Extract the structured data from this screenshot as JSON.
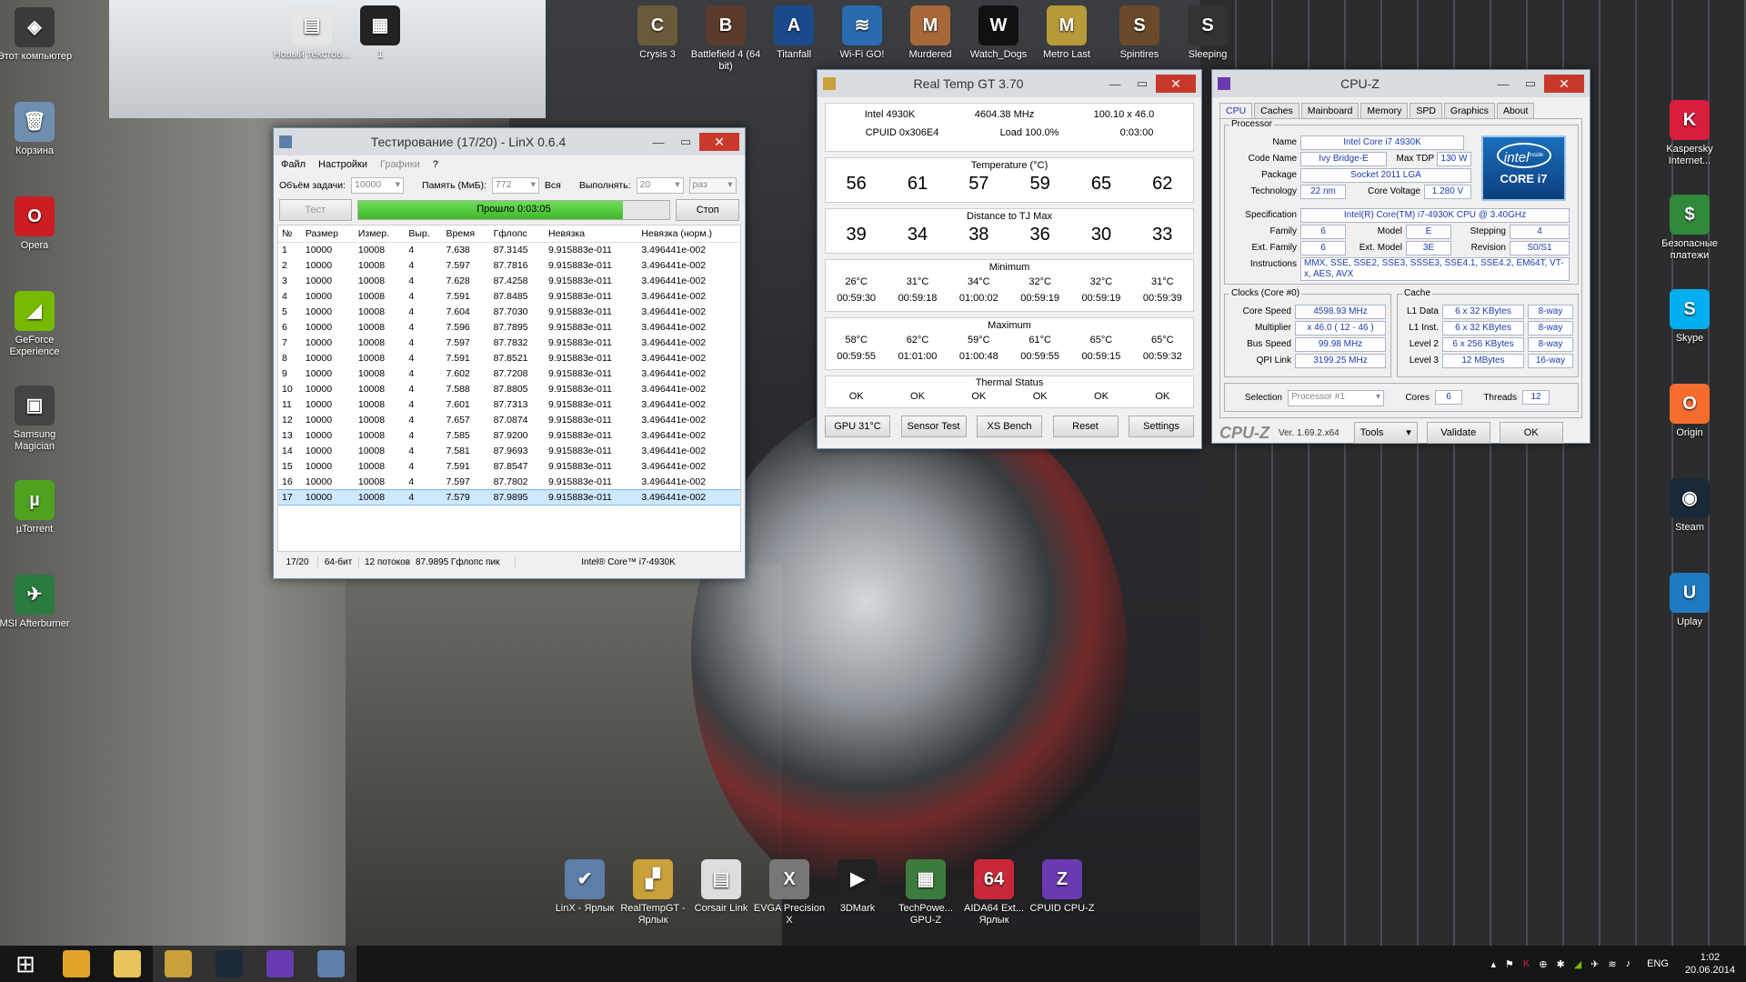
{
  "desktop_icons_left": [
    {
      "label": "Этот компьютер",
      "name": "this-pc-icon",
      "color": "#3a3a3a",
      "glyph": "◈"
    },
    {
      "label": "Корзина",
      "name": "recycle-bin-icon",
      "color": "#6f8fb0",
      "glyph": "🗑"
    },
    {
      "label": "Opera",
      "name": "opera-icon",
      "color": "#cc1d22",
      "glyph": "O"
    },
    {
      "label": "GeForce Experience",
      "name": "geforce-icon",
      "color": "#76b900",
      "glyph": "◢"
    },
    {
      "label": "Samsung Magician",
      "name": "samsung-magician-icon",
      "color": "#444",
      "glyph": "▣"
    },
    {
      "label": "µTorrent",
      "name": "utorrent-icon",
      "color": "#4ea21e",
      "glyph": "µ"
    },
    {
      "label": "MSI Afterburner",
      "name": "afterburner-icon",
      "color": "#2b7a3f",
      "glyph": "✈"
    }
  ],
  "desktop_icons_top": [
    {
      "label": "Новый текстов...",
      "name": "new-text-icon",
      "color": "#e6e6e6",
      "glyph": "▤"
    },
    {
      "label": "1",
      "name": "image-icon",
      "color": "#222",
      "glyph": "▦"
    },
    {
      "label": "Crysis 3",
      "name": "crysis-icon",
      "color": "#6b5a3a",
      "glyph": "C"
    },
    {
      "label": "Battlefield 4 (64 bit)",
      "name": "battlefield-icon",
      "color": "#5a3a2a",
      "glyph": "B"
    },
    {
      "label": "Titanfall",
      "name": "titanfall-icon",
      "color": "#1b4a8c",
      "glyph": "A"
    },
    {
      "label": "Wi-Fi GO!",
      "name": "wifi-go-icon",
      "color": "#2a6bb0",
      "glyph": "≋"
    },
    {
      "label": "Murdered",
      "name": "murdered-icon",
      "color": "#a8683a",
      "glyph": "M"
    },
    {
      "label": "Watch_Dogs",
      "name": "watchdogs-icon",
      "color": "#111",
      "glyph": "W"
    },
    {
      "label": "Metro Last",
      "name": "metro-icon",
      "color": "#b89a3a",
      "glyph": "M"
    },
    {
      "label": "Spintires",
      "name": "spintires-icon",
      "color": "#6a4a2a",
      "glyph": "S"
    },
    {
      "label": "Sleeping",
      "name": "sleeping-dogs-icon",
      "color": "#333",
      "glyph": "S"
    }
  ],
  "desktop_icons_right": [
    {
      "label": "Kaspersky Internet...",
      "name": "kaspersky-icon",
      "color": "#d81e3c",
      "glyph": "K"
    },
    {
      "label": "Безопасные платежи",
      "name": "safe-money-icon",
      "color": "#2f8a3a",
      "glyph": "$"
    },
    {
      "label": "Skype",
      "name": "skype-icon",
      "color": "#00aff0",
      "glyph": "S"
    },
    {
      "label": "Origin",
      "name": "origin-icon",
      "color": "#f56c2d",
      "glyph": "O"
    },
    {
      "label": "Steam",
      "name": "steam-icon",
      "color": "#1b2838",
      "glyph": "◉"
    },
    {
      "label": "Uplay",
      "name": "uplay-icon",
      "color": "#1f7bc1",
      "glyph": "U"
    }
  ],
  "desktop_icons_bottom": [
    {
      "label": "LinX - Ярлык",
      "name": "linx-shortcut-icon",
      "color": "#5c7ea8",
      "glyph": "✔"
    },
    {
      "label": "RealTempGT - Ярлык",
      "name": "realtemp-shortcut-icon",
      "color": "#c9a03a",
      "glyph": "▞"
    },
    {
      "label": "Corsair Link",
      "name": "corsair-icon",
      "color": "#ddd",
      "glyph": "▤"
    },
    {
      "label": "EVGA Precision X",
      "name": "evga-icon",
      "color": "#777",
      "glyph": "X"
    },
    {
      "label": "3DMark",
      "name": "3dmark-icon",
      "color": "#222",
      "glyph": "▶"
    },
    {
      "label": "TechPowe... GPU-Z",
      "name": "gpuz-icon",
      "color": "#3d7a3d",
      "glyph": "▦"
    },
    {
      "label": "AIDA64 Ext... Ярлык",
      "name": "aida64-icon",
      "color": "#c8283a",
      "glyph": "64"
    },
    {
      "label": "CPUID CPU-Z",
      "name": "cpuz-icon",
      "color": "#6a3ab0",
      "glyph": "Z"
    }
  ],
  "linx": {
    "title": "Тестирование (17/20) - LinX 0.6.4",
    "menu": [
      "Файл",
      "Настройки",
      "Графики",
      "?"
    ],
    "size_label": "Объём задачи:",
    "size_value": "10000",
    "mem_label": "Память (МиБ):",
    "mem_value": "772",
    "all_label": "Вся",
    "runs_label": "Выполнять:",
    "runs_value": "20",
    "runs_unit": "раз",
    "test_button": "Тест",
    "progress_text": "Прошло 0:03:05",
    "progress": 0.85,
    "stop_button": "Стоп",
    "columns": [
      "№",
      "Размер",
      "Измер.",
      "Выр.",
      "Время",
      "Гфлопс",
      "Невязка",
      "Невязка (норм.)"
    ],
    "rows": [
      [
        "1",
        "10000",
        "10008",
        "4",
        "7.638",
        "87.3145",
        "9.915883e-011",
        "3.496441e-002"
      ],
      [
        "2",
        "10000",
        "10008",
        "4",
        "7.597",
        "87.7816",
        "9.915883e-011",
        "3.496441e-002"
      ],
      [
        "3",
        "10000",
        "10008",
        "4",
        "7.628",
        "87.4258",
        "9.915883e-011",
        "3.496441e-002"
      ],
      [
        "4",
        "10000",
        "10008",
        "4",
        "7.591",
        "87.8485",
        "9.915883e-011",
        "3.496441e-002"
      ],
      [
        "5",
        "10000",
        "10008",
        "4",
        "7.604",
        "87.7030",
        "9.915883e-011",
        "3.496441e-002"
      ],
      [
        "6",
        "10000",
        "10008",
        "4",
        "7.596",
        "87.7895",
        "9.915883e-011",
        "3.496441e-002"
      ],
      [
        "7",
        "10000",
        "10008",
        "4",
        "7.597",
        "87.7832",
        "9.915883e-011",
        "3.496441e-002"
      ],
      [
        "8",
        "10000",
        "10008",
        "4",
        "7.591",
        "87.8521",
        "9.915883e-011",
        "3.496441e-002"
      ],
      [
        "9",
        "10000",
        "10008",
        "4",
        "7.602",
        "87.7208",
        "9.915883e-011",
        "3.496441e-002"
      ],
      [
        "10",
        "10000",
        "10008",
        "4",
        "7.588",
        "87.8805",
        "9.915883e-011",
        "3.496441e-002"
      ],
      [
        "11",
        "10000",
        "10008",
        "4",
        "7.601",
        "87.7313",
        "9.915883e-011",
        "3.496441e-002"
      ],
      [
        "12",
        "10000",
        "10008",
        "4",
        "7.657",
        "87.0874",
        "9.915883e-011",
        "3.496441e-002"
      ],
      [
        "13",
        "10000",
        "10008",
        "4",
        "7.585",
        "87.9200",
        "9.915883e-011",
        "3.496441e-002"
      ],
      [
        "14",
        "10000",
        "10008",
        "4",
        "7.581",
        "87.9693",
        "9.915883e-011",
        "3.496441e-002"
      ],
      [
        "15",
        "10000",
        "10008",
        "4",
        "7.591",
        "87.8547",
        "9.915883e-011",
        "3.496441e-002"
      ],
      [
        "16",
        "10000",
        "10008",
        "4",
        "7.597",
        "87.7802",
        "9.915883e-011",
        "3.496441e-002"
      ],
      [
        "17",
        "10000",
        "10008",
        "4",
        "7.579",
        "87.9895",
        "9.915883e-011",
        "3.496441e-002"
      ]
    ],
    "status": [
      "17/20",
      "64-бит",
      "12 потоков",
      "87.9895 Гфлопс пик",
      "Intel® Core™ i7-4930K"
    ]
  },
  "realtemp": {
    "title": "Real Temp GT 3.70",
    "cpu": "Intel 4930K",
    "freq": "4604.38 MHz",
    "multi": "100.10 x 46.0",
    "cpuid": "CPUID  0x306E4",
    "load": "Load 100.0%",
    "time": "0:03:00",
    "temp_header": "Temperature (°C)",
    "temps": [
      "56",
      "61",
      "57",
      "59",
      "65",
      "62"
    ],
    "tj_header": "Distance to TJ Max",
    "tj": [
      "39",
      "34",
      "38",
      "36",
      "30",
      "33"
    ],
    "min_header": "Minimum",
    "min_temps": [
      "26°C",
      "31°C",
      "34°C",
      "32°C",
      "32°C",
      "31°C"
    ],
    "min_times": [
      "00:59:30",
      "00:59:18",
      "01:00:02",
      "00:59:19",
      "00:59:19",
      "00:59:39"
    ],
    "max_header": "Maximum",
    "max_temps": [
      "58°C",
      "62°C",
      "59°C",
      "61°C",
      "65°C",
      "65°C"
    ],
    "max_times": [
      "00:59:55",
      "01:01:00",
      "01:00:48",
      "00:59:55",
      "00:59:15",
      "00:59:32"
    ],
    "thermal_header": "Thermal Status",
    "status": [
      "OK",
      "OK",
      "OK",
      "OK",
      "OK",
      "OK"
    ],
    "buttons": [
      "GPU  31°C",
      "Sensor Test",
      "XS Bench",
      "Reset",
      "Settings"
    ]
  },
  "cpuz": {
    "title": "CPU-Z",
    "tabs": [
      "CPU",
      "Caches",
      "Mainboard",
      "Memory",
      "SPD",
      "Graphics",
      "About"
    ],
    "processor_label": "Processor",
    "name_label": "Name",
    "name": "Intel Core i7 4930K",
    "codename_label": "Code Name",
    "codename": "Ivy Bridge-E",
    "maxtdp_label": "Max TDP",
    "maxtdp": "130 W",
    "package_label": "Package",
    "package": "Socket 2011 LGA",
    "tech_label": "Technology",
    "tech": "22 nm",
    "voltage_label": "Core Voltage",
    "voltage": "1.280 V",
    "spec_label": "Specification",
    "spec": "Intel(R) Core(TM) i7-4930K CPU @ 3.40GHz",
    "family_label": "Family",
    "family": "6",
    "model_label": "Model",
    "model": "E",
    "stepping_label": "Stepping",
    "stepping": "4",
    "extfamily_label": "Ext. Family",
    "extfamily": "6",
    "extmodel_label": "Ext. Model",
    "extmodel": "3E",
    "revision_label": "Revision",
    "revision": "S0/S1",
    "instr_label": "Instructions",
    "instr": "MMX, SSE, SSE2, SSE3, SSSE3, SSE4.1, SSE4.2, EM64T, VT-x, AES, AVX",
    "clocks_label": "Clocks (Core #0)",
    "corespeed_label": "Core Speed",
    "corespeed": "4598.93 MHz",
    "multiplier_label": "Multiplier",
    "multiplier": "x 46.0 ( 12 - 46 )",
    "busspeed_label": "Bus Speed",
    "busspeed": "99.98 MHz",
    "qpi_label": "QPI Link",
    "qpi": "3199.25 MHz",
    "cache_label": "Cache",
    "l1d_label": "L1 Data",
    "l1d": "6 x 32 KBytes",
    "l1d_way": "8-way",
    "l1i_label": "L1 Inst.",
    "l1i": "6 x 32 KBytes",
    "l1i_way": "8-way",
    "l2_label": "Level 2",
    "l2": "6 x 256 KBytes",
    "l2_way": "8-way",
    "l3_label": "Level 3",
    "l3": "12 MBytes",
    "l3_way": "16-way",
    "selection_label": "Selection",
    "selection": "Processor #1",
    "cores_label": "Cores",
    "cores": "6",
    "threads_label": "Threads",
    "threads": "12",
    "brand": "CPU-Z",
    "version": "Ver. 1.69.2.x64",
    "tools_button": "Tools",
    "validate_button": "Validate",
    "ok_button": "OK",
    "intel_badge": "intel",
    "intel_inside": "inside",
    "core_badge": "CORE i7"
  },
  "taskbar": {
    "items": [
      {
        "name": "start-button-icon",
        "color": "#fff"
      },
      {
        "name": "chrome-icon",
        "color": "#e2a52a"
      },
      {
        "name": "explorer-icon",
        "color": "#e8c45a"
      },
      {
        "name": "realtemp-task-icon",
        "color": "#c9a03a"
      },
      {
        "name": "steam-task-icon",
        "color": "#1b2838"
      },
      {
        "name": "cpuz-task-icon",
        "color": "#6a3ab0"
      },
      {
        "name": "linx-task-icon",
        "color": "#5c7ea8"
      }
    ],
    "lang": "ENG",
    "time": "1:02",
    "date": "20.06.2014"
  }
}
